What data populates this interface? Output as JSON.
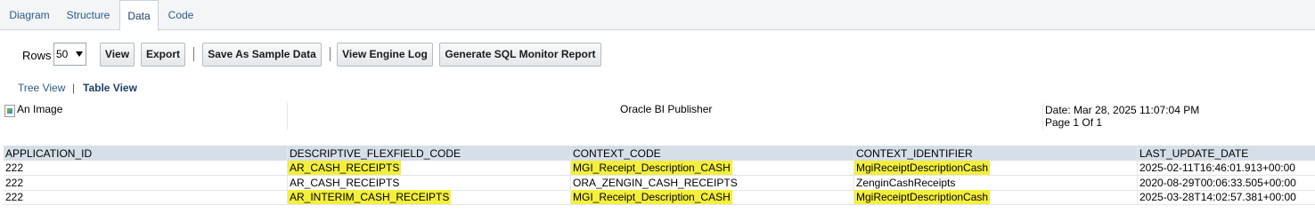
{
  "tabs": [
    {
      "label": "Diagram",
      "active": false
    },
    {
      "label": "Structure",
      "active": false
    },
    {
      "label": "Data",
      "active": true
    },
    {
      "label": "Code",
      "active": false
    }
  ],
  "toolbar": {
    "rows_label": "Rows",
    "rows_value": "50",
    "view_label": "View",
    "export_label": "Export",
    "save_sample_label": "Save As Sample Data",
    "engine_log_label": "View Engine Log",
    "sql_monitor_label": "Generate SQL Monitor Report"
  },
  "view_links": {
    "tree": "Tree View",
    "separator": "|",
    "table": "Table View"
  },
  "report_header": {
    "image_alt": "An Image",
    "title": "Oracle BI Publisher",
    "date": "Date: Mar 28, 2025 11:07:04 PM",
    "page": "Page 1 Of 1"
  },
  "table": {
    "columns": [
      "APPLICATION_ID",
      "DESCRIPTIVE_FLEXFIELD_CODE",
      "CONTEXT_CODE",
      "CONTEXT_IDENTIFIER",
      "LAST_UPDATE_DATE"
    ],
    "rows": [
      [
        "222",
        "AR_CASH_RECEIPTS",
        "MGI_Receipt_Description_CASH",
        "MgiReceiptDescriptionCash",
        "2025-02-11T16:46:01.913+00:00"
      ],
      [
        "222",
        "AR_CASH_RECEIPTS",
        "ORA_ZENGIN_CASH_RECEIPTS",
        "ZenginCashReceipts",
        "2020-08-29T00:06:33.505+00:00"
      ],
      [
        "222",
        "AR_INTERIM_CASH_RECEIPTS",
        "MGI_Receipt_Description_CASH",
        "MgiReceiptDescriptionCash",
        "2025-03-28T14:02:57.381+00:00"
      ]
    ],
    "highlight_color": "#f4ef3a"
  }
}
